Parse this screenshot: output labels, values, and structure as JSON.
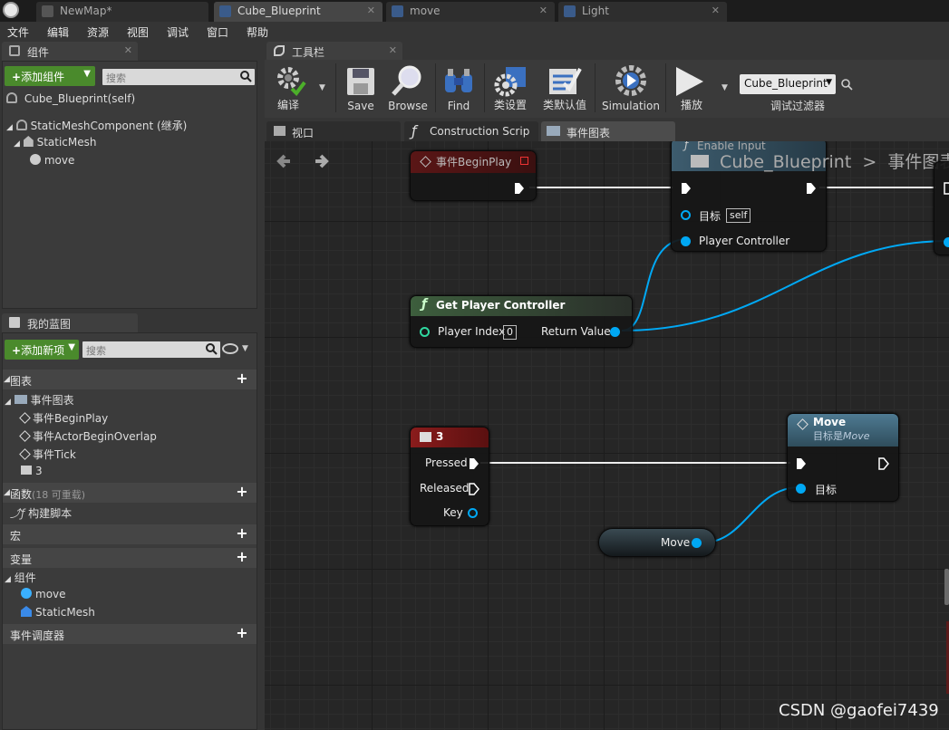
{
  "doc_tabs": [
    {
      "label": "NewMap*"
    },
    {
      "label": "Cube_Blueprint"
    },
    {
      "label": "move"
    },
    {
      "label": "Light"
    }
  ],
  "menu": [
    "文件",
    "编辑",
    "资源",
    "视图",
    "调试",
    "窗口",
    "帮助"
  ],
  "components_panel": {
    "tab_label": "组件",
    "add_button": "添加组件",
    "search_placeholder": "搜索",
    "root": "Cube_Blueprint(self)",
    "tree": [
      "StaticMeshComponent (继承)",
      "StaticMesh",
      "move"
    ]
  },
  "my_blueprint_panel": {
    "tab_label": "我的蓝图",
    "add_button": "添加新项",
    "search_placeholder": "搜索",
    "graphs_header": "图表",
    "event_graph": "事件图表",
    "events": [
      "事件BeginPlay",
      "事件ActorBeginOverlap",
      "事件Tick",
      "3"
    ],
    "functions_header": "函数",
    "functions_note": "(18 可重载)",
    "construct_script": "构建脚本",
    "macros_header": "宏",
    "variables_header": "变量",
    "components_header": "组件",
    "component_vars": [
      "move",
      "StaticMesh"
    ],
    "dispatchers_header": "事件调度器"
  },
  "toolbar": {
    "tab_label": "工具栏",
    "buttons": {
      "compile": "编译",
      "save": "Save",
      "browse": "Browse",
      "find": "Find",
      "class_settings": "类设置",
      "class_defaults": "类默认值",
      "simulation": "Simulation",
      "play": "播放"
    },
    "debug_target": "Cube_Blueprint",
    "debug_filter_label": "调试过滤器"
  },
  "editor_tabs": [
    "视口",
    "Construction Scrip",
    "事件图表"
  ],
  "graph": {
    "breadcrumb_blueprint": "Cube_Blueprint",
    "breadcrumb_separator": ">",
    "breadcrumb_graph": "事件图表",
    "nodes": {
      "begin_play": {
        "title": "事件BeginPlay"
      },
      "enable_input": {
        "title": "Enable Input",
        "target_label": "目标",
        "target_value": "self",
        "player_controller": "Player Controller"
      },
      "get_player_controller": {
        "title": "Get Player Controller",
        "player_index_label": "Player Index",
        "player_index_value": "0",
        "return_value": "Return Value"
      },
      "key_event": {
        "title": "3",
        "pressed": "Pressed",
        "released": "Released",
        "key": "Key"
      },
      "move_call": {
        "title": "Move",
        "subtitle_prefix": "目标是",
        "subtitle_italic": "Move",
        "target_label": "目标"
      },
      "move_var": {
        "label": "Move"
      }
    }
  },
  "watermark": "CSDN @gaofei7439",
  "colors": {
    "exec_wire": "#ffffff",
    "object_wire": "#00a8f4",
    "add_button": "#4a8a2c",
    "event_header": "#7a1a1a",
    "function_header": "#2f4a2f",
    "call_header": "#3e6275"
  }
}
